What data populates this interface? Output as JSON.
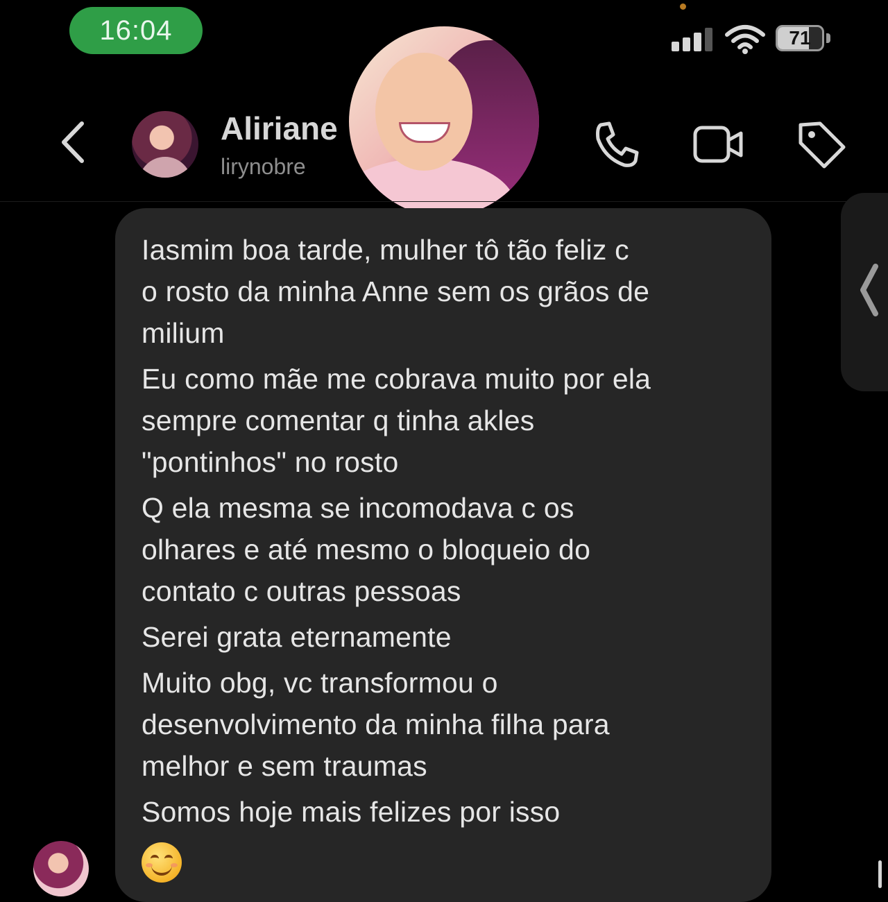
{
  "status_bar": {
    "time": "16:04",
    "battery_percent": "71",
    "battery_level": 0.71,
    "signal_bars": 3,
    "icons": [
      "signal-icon",
      "wifi-icon",
      "battery-icon"
    ]
  },
  "header": {
    "back_icon": "chevron-left-icon",
    "contact_name": "Aliriane",
    "username": "lirynobre",
    "actions": [
      "phone-icon",
      "video-camera-icon",
      "tag-icon"
    ]
  },
  "message": {
    "paragraphs": [
      [
        "Iasmim boa tarde, mulher tô tão feliz c",
        "o rosto da minha Anne sem os grãos de",
        "milium"
      ],
      [
        "Eu como mãe me cobrava muito por ela",
        "sempre comentar q tinha akles",
        "\"pontinhos\" no rosto"
      ],
      [
        "Q ela mesma se incomodava c os",
        "olhares e até mesmo o bloqueio do",
        "contato c outras pessoas"
      ],
      [
        "Serei grata eternamente"
      ],
      [
        "Muito obg, vc transformou o",
        "desenvolvimento da minha filha para",
        "melhor e sem traumas"
      ],
      [
        "Somos hoje mais felizes por isso"
      ]
    ],
    "emoji": "smiling-face-icon"
  },
  "colors": {
    "background": "#000000",
    "bubble": "#262626",
    "time_pill": "#2f9e47",
    "text": "#e6e6e6",
    "muted": "#8e8e8e"
  }
}
